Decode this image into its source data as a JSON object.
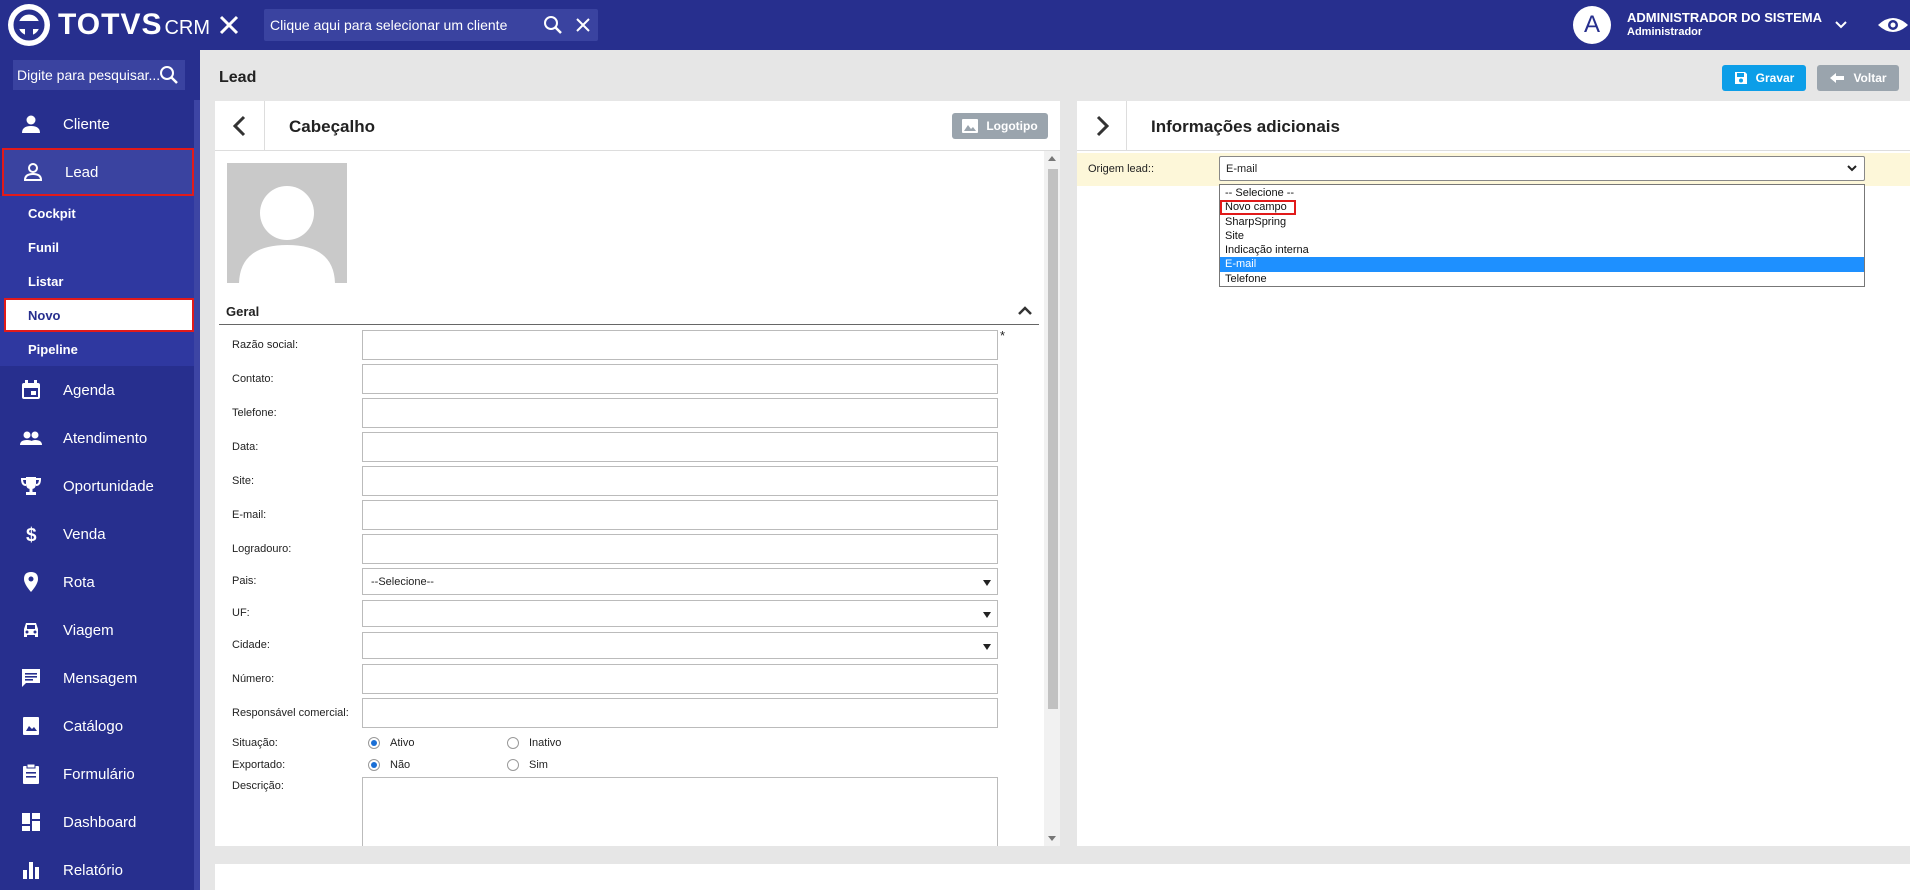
{
  "app": {
    "brand": "TOTVS",
    "product": "CRM"
  },
  "topbar": {
    "client_search_placeholder": "Clique aqui para selecionar um cliente",
    "user_initial": "A",
    "user_name": "ADMINISTRADOR DO SISTEMA",
    "user_role": "Administrador"
  },
  "sidebar": {
    "search_placeholder": "Digite para pesquisar...",
    "items": [
      {
        "label": "Cliente",
        "icon": "person-icon"
      },
      {
        "label": "Lead",
        "icon": "person-outline-icon",
        "active": true
      },
      {
        "label": "Agenda",
        "icon": "calendar-icon"
      },
      {
        "label": "Atendimento",
        "icon": "people-icon"
      },
      {
        "label": "Oportunidade",
        "icon": "trophy-icon"
      },
      {
        "label": "Venda",
        "icon": "dollar-icon"
      },
      {
        "label": "Rota",
        "icon": "location-pin-icon"
      },
      {
        "label": "Viagem",
        "icon": "car-icon"
      },
      {
        "label": "Mensagem",
        "icon": "message-icon"
      },
      {
        "label": "Catálogo",
        "icon": "catalog-icon"
      },
      {
        "label": "Formulário",
        "icon": "clipboard-icon"
      },
      {
        "label": "Dashboard",
        "icon": "dashboard-icon"
      },
      {
        "label": "Relatório",
        "icon": "bar-chart-icon"
      }
    ],
    "lead_submenu": [
      "Cockpit",
      "Funil",
      "Listar",
      "Novo",
      "Pipeline"
    ],
    "selected_submenu": "Novo"
  },
  "page": {
    "title": "Lead",
    "save_label": "Gravar",
    "back_label": "Voltar"
  },
  "left_panel": {
    "title": "Cabeçalho",
    "logo_button": "Logotipo",
    "section": "Geral",
    "required_mark": "*",
    "fields": [
      {
        "label": "Razão social:",
        "value": ""
      },
      {
        "label": "Contato:",
        "value": ""
      },
      {
        "label": "Telefone:",
        "value": ""
      },
      {
        "label": "Data:",
        "value": ""
      },
      {
        "label": "Site:",
        "value": ""
      },
      {
        "label": "E-mail:",
        "value": ""
      },
      {
        "label": "Logradouro:",
        "value": ""
      },
      {
        "label": "Pais:",
        "value": "--Selecione--"
      },
      {
        "label": "UF:",
        "value": ""
      },
      {
        "label": "Cidade:",
        "value": ""
      },
      {
        "label": "Número:",
        "value": ""
      },
      {
        "label": "Responsável comercial:",
        "value": ""
      }
    ],
    "situacao": {
      "label": "Situação:",
      "options": [
        "Ativo",
        "Inativo"
      ],
      "selected": "Ativo"
    },
    "exportado": {
      "label": "Exportado:",
      "options": [
        "Não",
        "Sim"
      ],
      "selected": "Não"
    },
    "descricao_label": "Descrição:"
  },
  "right_panel": {
    "title": "Informações adicionais",
    "origem_label": "Origem lead::",
    "origem_value": "E-mail",
    "options": [
      "-- Selecione --",
      "Novo campo",
      "SharpSpring",
      "Site",
      "Indicação interna",
      "E-mail",
      "Telefone"
    ],
    "highlighted": "E-mail",
    "boxed": "Novo campo"
  },
  "colors": {
    "nav_bg": "#272f8e",
    "save_button": "#0c9ee8",
    "grey_button": "#9aa4ad",
    "highlight": "#e11a1a",
    "dropdown_selected": "#1e90ff"
  }
}
